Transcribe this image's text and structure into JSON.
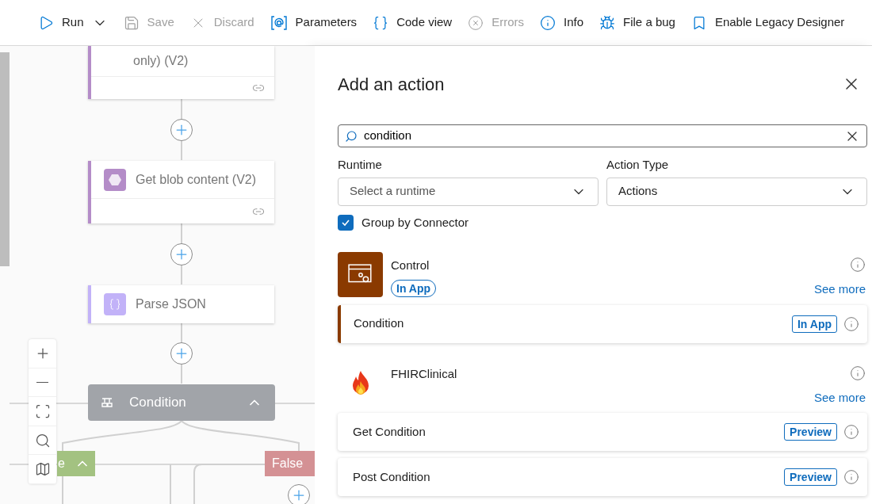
{
  "toolbar": [
    {
      "kind": "run",
      "label": "Run",
      "disabled": false
    },
    {
      "kind": "save",
      "label": "Save",
      "disabled": true
    },
    {
      "kind": "discard",
      "label": "Discard",
      "disabled": true
    },
    {
      "kind": "parameters",
      "label": "Parameters",
      "disabled": false
    },
    {
      "kind": "code",
      "label": "Code view",
      "disabled": false
    },
    {
      "kind": "errors",
      "label": "Errors",
      "disabled": true
    },
    {
      "kind": "info",
      "label": "Info",
      "disabled": false
    },
    {
      "kind": "bug",
      "label": "File a bug",
      "disabled": false
    },
    {
      "kind": "legacy",
      "label": "Enable Legacy Designer",
      "disabled": false
    }
  ],
  "canvas": {
    "nodes": [
      {
        "kind": "blob-partial",
        "title": "only) (V2)"
      },
      {
        "kind": "blob",
        "title": "Get blob content (V2)"
      },
      {
        "kind": "parse",
        "title": "Parse JSON"
      },
      {
        "kind": "condition",
        "title": "Condition",
        "expanded": true
      }
    ],
    "branches": [
      {
        "kind": "true",
        "label": "e"
      },
      {
        "kind": "false",
        "label": "False"
      }
    ]
  },
  "panel": {
    "title": "Add an action",
    "search": {
      "value": "condition"
    },
    "filters": [
      {
        "label": "Runtime",
        "placeholder": "Select a runtime"
      },
      {
        "label": "Action Type",
        "value": "Actions"
      }
    ],
    "group_by_connector": {
      "label": "Group by Connector",
      "checked": true
    },
    "groups": [
      {
        "kind": "control",
        "name": "Control",
        "badge": "In App",
        "see_more": "See more",
        "actions": [
          {
            "name": "Condition",
            "badge": "In App"
          }
        ]
      },
      {
        "kind": "fhir",
        "name": "FHIRClinical",
        "see_more": "See more",
        "actions": [
          {
            "name": "Get Condition",
            "badge": "Preview"
          },
          {
            "name": "Post Condition",
            "badge": "Preview"
          }
        ]
      }
    ]
  }
}
